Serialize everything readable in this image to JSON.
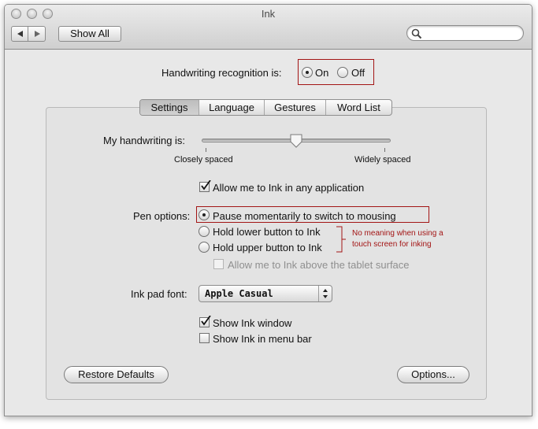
{
  "window": {
    "title": "Ink"
  },
  "toolbar": {
    "show_all_label": "Show All",
    "search": {
      "value": "",
      "placeholder": ""
    }
  },
  "recognition": {
    "label": "Handwriting recognition is:",
    "options": [
      {
        "label": "On",
        "selected": true
      },
      {
        "label": "Off",
        "selected": false
      }
    ]
  },
  "tabs": [
    {
      "label": "Settings",
      "active": true
    },
    {
      "label": "Language",
      "active": false
    },
    {
      "label": "Gestures",
      "active": false
    },
    {
      "label": "Word List",
      "active": false
    }
  ],
  "settings": {
    "handwriting_label": "My handwriting is:",
    "slider": {
      "min_label": "Closely spaced",
      "max_label": "Widely spaced",
      "value": 0.5
    },
    "allow_any_app": {
      "label": "Allow me to Ink in any application",
      "checked": true
    },
    "pen_options": {
      "label": "Pen options:",
      "options": [
        {
          "label": "Pause momentarily to switch to mousing",
          "selected": true
        },
        {
          "label": "Hold lower button to Ink",
          "selected": false
        },
        {
          "label": "Hold upper button to Ink",
          "selected": false
        }
      ],
      "above_tablet": {
        "label": "Allow me to Ink above the tablet surface",
        "checked": false,
        "disabled": true
      }
    },
    "annotation": {
      "line1": "No meaning when using a",
      "line2": "touch screen for inking"
    },
    "font": {
      "label": "Ink pad font:",
      "value": "Apple Casual"
    },
    "show_window": {
      "label": "Show Ink window",
      "checked": true
    },
    "show_menu_bar": {
      "label": "Show Ink in menu bar",
      "checked": false
    },
    "restore_label": "Restore Defaults",
    "options_label": "Options..."
  }
}
